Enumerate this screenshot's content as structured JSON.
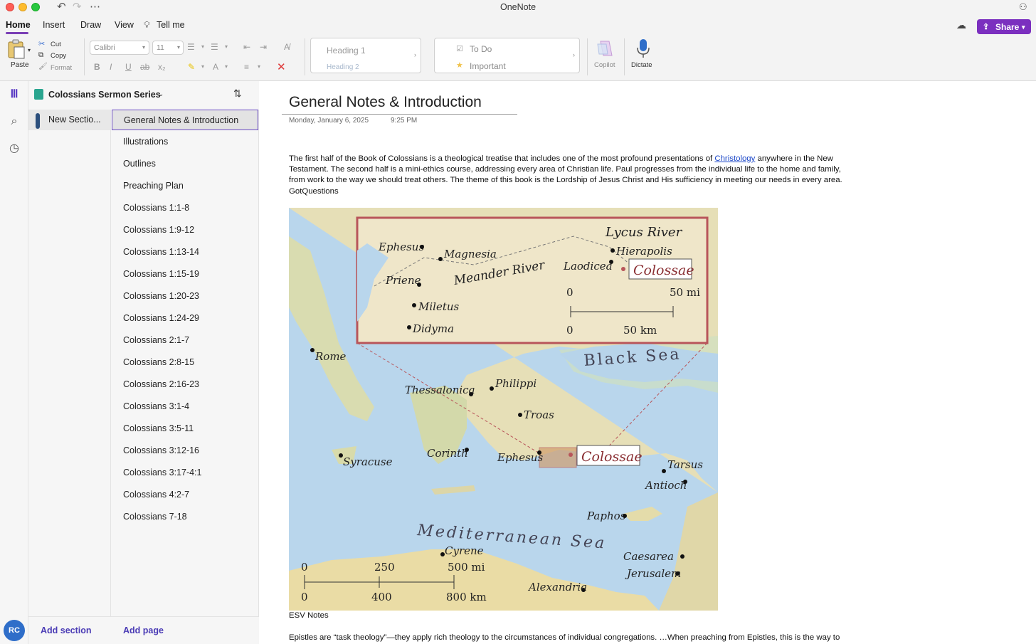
{
  "window": {
    "title": "OneNote"
  },
  "tabs": [
    "Home",
    "Insert",
    "Draw",
    "View"
  ],
  "tell_me": "Tell me",
  "share_label": "Share",
  "ribbon": {
    "paste": "Paste",
    "cut": "Cut",
    "copy": "Copy",
    "format": "Format",
    "font_family": "Calibri",
    "font_size": "11",
    "styles": [
      "Heading 1",
      "Heading 2"
    ],
    "tags": [
      "To Do",
      "Important"
    ],
    "copilot": "Copilot",
    "dictate": "Dictate"
  },
  "notebook": {
    "name": "Colossians Sermon Series",
    "section": "New Sectio...",
    "add_section": "Add section",
    "add_page": "Add page",
    "pages": [
      "General Notes & Introduction",
      "Illustrations",
      "Outlines",
      "Preaching Plan",
      "Colossians 1:1-8",
      "Colossians 1:9-12",
      "Colossians 1:13-14",
      "Colossians 1:15-19",
      "Colossians 1:20-23",
      "Colossians 1:24-29",
      "Colossians 2:1-7",
      "Colossians 2:8-15",
      "Colossians 2:16-23",
      "Colossians 3:1-4",
      "Colossians 3:5-11",
      "Colossians 3:12-16",
      "Colossians 3:17-4:1",
      "Colossians 4:2-7",
      "Colossians 7-18"
    ],
    "active_page_index": 0
  },
  "user_initials": "RC",
  "page": {
    "title": "General Notes & Introduction",
    "date": "Monday, January 6, 2025",
    "time": "9:25 PM",
    "para1_before": "The first half of the Book of Colossians is a theological treatise that includes one of the most profound presentations of ",
    "para1_link": "Christology",
    "para1_after": " anywhere in the New Testament. The second half is a mini-ethics course, addressing every area of Christian life. Paul progresses from the individual life to the home and family, from work to the way we should treat others. The theme of this book is the Lordship of Jesus Christ and His sufficiency in meeting our needs in every area.",
    "para1_source": "GotQuestions",
    "caption": "ESV Notes",
    "para2": "Epistles are “task theology”—they apply rich theology to the circumstances of individual congregations. …When preaching from Epistles, this is the way to"
  },
  "map": {
    "inset_places": [
      "Ephesus",
      "Magnesia",
      "Priene",
      "Miletus",
      "Didyma",
      "Hierapolis",
      "Laodicea",
      "Colossae"
    ],
    "inset_labels": [
      "Lycus River",
      "Meander River"
    ],
    "inset_scale": [
      "0",
      "50 mi",
      "0",
      "50 km"
    ],
    "seas": [
      "Black Sea",
      "Mediterranean Sea"
    ],
    "places": [
      "Rome",
      "Thessalonica",
      "Philippi",
      "Troas",
      "Corinth",
      "Ephesus",
      "Colossae",
      "Syracuse",
      "Tarsus",
      "Antioch",
      "Paphos",
      "Cyrene",
      "Caesarea",
      "Jerusalem",
      "Alexandria"
    ],
    "scale_mi": [
      "0",
      "250",
      "500 mi"
    ],
    "scale_km": [
      "0",
      "400",
      "800 km"
    ]
  },
  "colors": {
    "accent": "#7b2fbf",
    "link": "#1a46c8",
    "section_color": "#2c4f7c"
  }
}
